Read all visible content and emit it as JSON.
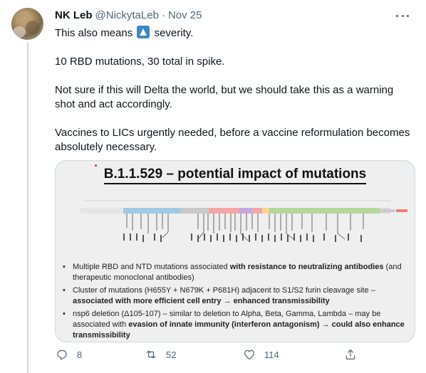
{
  "tweet": {
    "name": "NK Leb",
    "handle": "@NickytaLeb",
    "separator": "·",
    "date": "Nov 25",
    "lines": {
      "l1_before": "This also means",
      "l1_after": "severity.",
      "l2": "10 RBD mutations, 30 total in spike.",
      "l3": "Not sure if this will Delta the world, but we should take this as a warning shot and act accordingly.",
      "l4": "Vaccines to LICs urgently needed, before a vaccine reformulation becomes absolutely necessary."
    },
    "emoji": "up-arrow-emoji"
  },
  "slide": {
    "title": "B.1.1.529 – potential impact of mutations",
    "bullets": [
      {
        "pre": "Multiple RBD and NTD mutations associated ",
        "bold": "with resistance to neutralizing antibodies",
        "post": " (and therapeutic monoclonal antibodies)"
      },
      {
        "pre": "Cluster of mutations (H655Y + N679K + P681H) adjacent to S1/S2 furin cleavage site – ",
        "bold": "associated with more efficient cell entry → enhanced transmissibility",
        "post": ""
      },
      {
        "pre": "nsp6 deletion (Δ105-107) – similar to deletion to Alpha, Beta, Gamma, Lambda – may be associated with ",
        "bold": "evasion of innate immunity (interferon antagonism) → could also enhance transmissibility",
        "post": ""
      }
    ]
  },
  "actions": {
    "replies": "8",
    "retweets": "52",
    "likes": "114"
  },
  "colors": {
    "text": "#0f1419",
    "muted": "#536471",
    "border": "#cfd9de",
    "emoji_blue": "#3b88c3"
  }
}
